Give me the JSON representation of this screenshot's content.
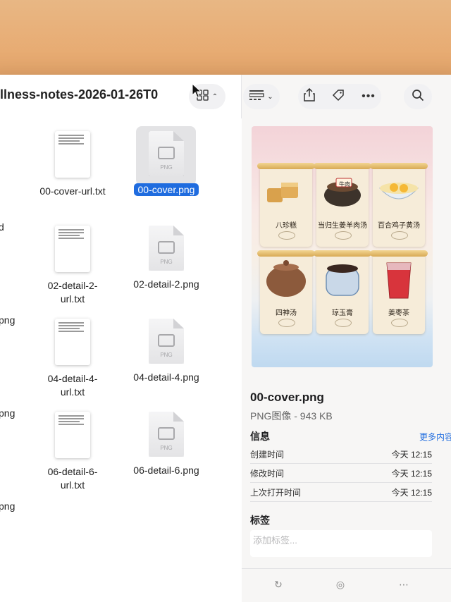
{
  "window": {
    "title": "llness-notes-2026-01-26T0...",
    "view_toggle_icon": "grid-icon",
    "preview_view_icon": "gallery-icon",
    "share_icon": "share-icon",
    "tag_icon": "tag-icon",
    "more_icon": "ellipsis-icon",
    "search_icon": "search-icon"
  },
  "files": [
    {
      "name": "00-cover-url.txt",
      "type": "txt"
    },
    {
      "name": "00-cover.png",
      "type": "png",
      "selected": true
    },
    {
      "name": "02-detail-2-url.txt",
      "type": "txt",
      "line1": "02-detail-2-",
      "line2": "url.txt"
    },
    {
      "name": "02-detail-2.png",
      "type": "png"
    },
    {
      "name": "04-detail-4-url.txt",
      "type": "txt",
      "line1": "04-detail-4-",
      "line2": "url.txt"
    },
    {
      "name": "04-detail-4.png",
      "type": "png"
    },
    {
      "name": "06-detail-6-url.txt",
      "type": "txt",
      "line1": "06-detail-6-",
      "line2": "url.txt"
    },
    {
      "name": "06-detail-6.png",
      "type": "png"
    }
  ],
  "partial_left": [
    "d",
    "png",
    "png",
    "png"
  ],
  "png_thumb_label": "PNG",
  "cover_items": [
    {
      "label": "八珍糕"
    },
    {
      "label": "当归生姜羊肉汤"
    },
    {
      "label": "百合鸡子黄汤"
    },
    {
      "label": "四神汤"
    },
    {
      "label": "琼玉膏"
    },
    {
      "label": "姜枣茶"
    }
  ],
  "cover_badge": "牛肉",
  "preview": {
    "filename": "00-cover.png",
    "kind": "PNG图像 - 943 KB",
    "info_title": "信息",
    "more_label": "更多内容",
    "rows": [
      {
        "key": "创建时间",
        "value": "今天 12:15"
      },
      {
        "key": "修改时间",
        "value": "今天 12:15"
      },
      {
        "key": "上次打开时间",
        "value": "今天 12:15"
      }
    ],
    "tags_title": "标签",
    "tags_placeholder": "添加标签..."
  },
  "colors": {
    "selection": "#1f6cdf",
    "link": "#1f6cdf"
  }
}
